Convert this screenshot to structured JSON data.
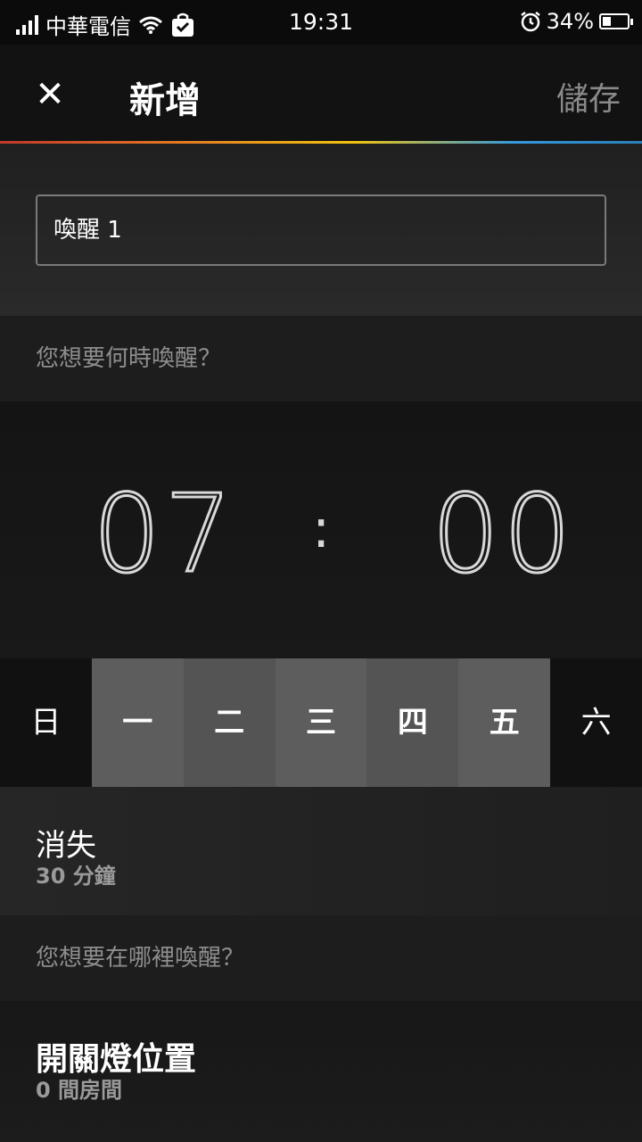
{
  "status_bar": {
    "carrier": "中華電信",
    "time": "19:31",
    "battery": "34%",
    "battery_level": 0.34,
    "icons": [
      "signal-icon",
      "wifi-icon",
      "shopping-bag-check-icon",
      "alarm-icon",
      "battery-icon"
    ]
  },
  "header": {
    "close_icon": "✕",
    "title": "新增",
    "save_label": "儲存"
  },
  "name_input": {
    "value": "喚醒 1"
  },
  "when_section": {
    "label": "您想要何時喚醒？"
  },
  "time_picker": {
    "hours": "07",
    "separator": ":",
    "minutes": "00"
  },
  "days": [
    {
      "label": "日",
      "selected": false
    },
    {
      "label": "一",
      "selected": true
    },
    {
      "label": "二",
      "selected": true
    },
    {
      "label": "三",
      "selected": true
    },
    {
      "label": "四",
      "selected": true
    },
    {
      "label": "五",
      "selected": true
    },
    {
      "label": "六",
      "selected": false
    }
  ],
  "duration": {
    "title": "消失",
    "value": "30 分鐘"
  },
  "where_section": {
    "label": "您想要在哪裡喚醒？"
  },
  "location": {
    "title": "開關燈位置",
    "value": "0 間房間"
  },
  "colors": {
    "selected_day": "#5d5d5d",
    "secondary_text": "#8e8e8e"
  }
}
